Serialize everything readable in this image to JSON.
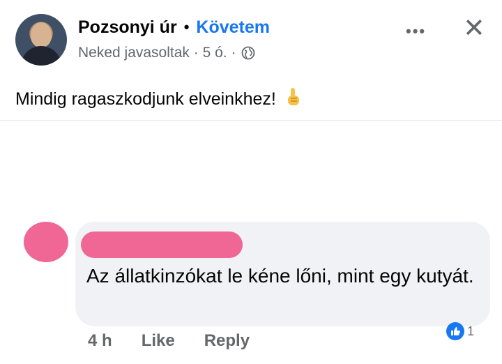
{
  "post": {
    "author": "Pozsonyi úr",
    "separator": "•",
    "follow_label": "Követem",
    "meta": "Neked javasoltak · 5 ó. ·",
    "text": "Mindig ragaszkodjunk elveinkhez!",
    "more_icon": "more-icon",
    "close_icon": "close-icon"
  },
  "comment": {
    "text": "Az állatkinzókat le kéne lőni, mint egy kutyát.",
    "time": "4 h",
    "like_label": "Like",
    "reply_label": "Reply",
    "reaction_count": "1"
  },
  "colors": {
    "brand": "#1877f2",
    "redaction": "#f06694",
    "secondary_text": "#65676b",
    "bubble": "#f0f2f5"
  }
}
